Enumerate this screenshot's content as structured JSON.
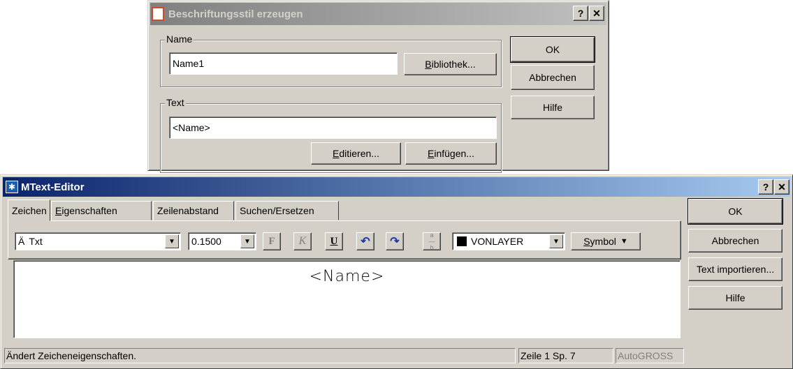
{
  "dialog_back": {
    "title": "Beschriftungsstil erzeugen",
    "help_btn": "?",
    "close_btn": "✕",
    "name_group": "Name",
    "name_value": "Name1",
    "bibliothek_btn": "Bibliothek...",
    "text_group": "Text",
    "text_value": "<Name>",
    "editieren_btn": "Editieren...",
    "einfuegen_btn": "Einfügen...",
    "ok_btn": "OK",
    "abbrechen_btn": "Abbrechen",
    "hilfe_btn": "Hilfe"
  },
  "mtext_editor": {
    "title": "MText-Editor",
    "help_btn": "?",
    "close_btn": "✕",
    "tabs": [
      {
        "label": "Zeichen"
      },
      {
        "label": "Eigenschaften"
      },
      {
        "label": "Zeilenabstand"
      },
      {
        "label": "Suchen/Ersetzen"
      }
    ],
    "font_value": "Txt",
    "height_value": "0.1500",
    "bold_glyph": "F",
    "italic_glyph": "K",
    "underline_glyph": "U",
    "color_value": "VONLAYER",
    "symbol_btn": "Symbol",
    "editor_text": "<Name>",
    "ok_btn": "OK",
    "abbrechen_btn": "Abbrechen",
    "import_btn": "Text importieren...",
    "hilfe_btn": "Hilfe",
    "status_text": "Ändert Zeicheneigenschaften.",
    "position_text": "Zeile 1 Sp. 7",
    "autogross_text": "AutoGROSS"
  }
}
